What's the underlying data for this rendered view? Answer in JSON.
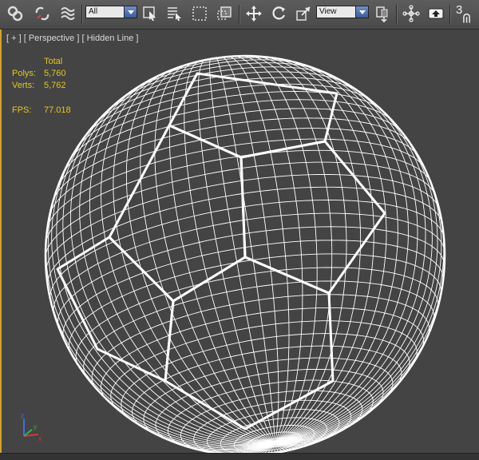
{
  "toolbar": {
    "selection_filter": "All",
    "reference_coord": "View",
    "snap_value": "3",
    "buttons": [
      {
        "name": "select-and-link-icon"
      },
      {
        "name": "unlink-selection-icon"
      },
      {
        "name": "bind-to-space-warp-icon"
      },
      {
        "name": "select-object-icon"
      },
      {
        "name": "select-by-name-icon"
      },
      {
        "name": "rectangular-selection-region-icon"
      },
      {
        "name": "window-crossing-icon"
      },
      {
        "name": "select-and-move-icon"
      },
      {
        "name": "select-and-rotate-icon"
      },
      {
        "name": "select-and-scale-icon"
      },
      {
        "name": "use-pivot-center-icon"
      },
      {
        "name": "select-and-manipulate-icon"
      },
      {
        "name": "keyboard-shortcut-override-icon"
      },
      {
        "name": "snaps-toggle-icon"
      }
    ]
  },
  "viewport": {
    "label_plus": "[ + ]",
    "label_view": "[ Perspective ]",
    "label_shading": "[ Hidden Line ]",
    "stats": {
      "header": "Total",
      "polys_label": "Polys:",
      "polys_value": "5,760",
      "verts_label": "Verts:",
      "verts_value": "5,762",
      "fps_label": "FPS:",
      "fps_value": "77.018"
    },
    "object": "soccer-ball-wireframe",
    "colors": {
      "stats_text": "#e3c71c",
      "wire": "#ffffff",
      "active_border": "#d4a22a",
      "background": "#444444"
    }
  }
}
